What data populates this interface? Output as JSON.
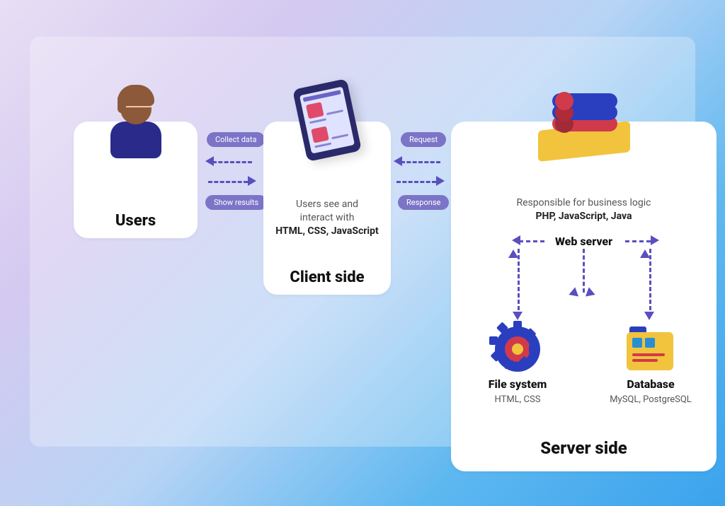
{
  "users": {
    "title": "Users"
  },
  "flow1": {
    "top_label": "Collect data",
    "bottom_label": "Show results"
  },
  "client": {
    "desc_line1": "Users see and",
    "desc_line2": "interact with",
    "desc_tech": "HTML, CSS, JavaScript",
    "title": "Client side"
  },
  "flow2": {
    "top_label": "Request",
    "bottom_label": "Response"
  },
  "server": {
    "desc_line1": "Responsible for business logic",
    "desc_tech": "PHP, JavaScript, Java",
    "web_server_label": "Web server",
    "file_system": {
      "title": "File system",
      "tech": "HTML, CSS"
    },
    "database": {
      "title": "Database",
      "tech": "MySQL, PostgreSQL"
    },
    "title": "Server side"
  }
}
